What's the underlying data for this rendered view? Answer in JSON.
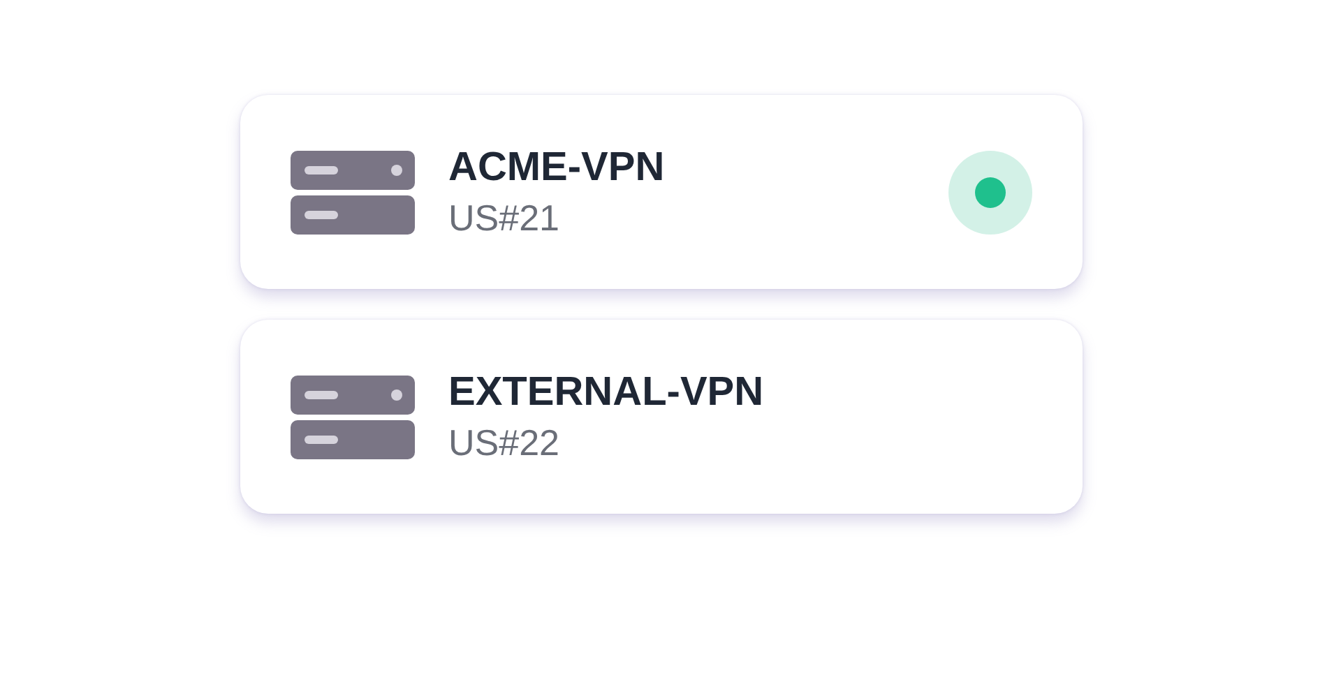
{
  "servers": [
    {
      "name": "ACME-VPN",
      "location": "US#21",
      "connected": true
    },
    {
      "name": "EXTERNAL-VPN",
      "location": "US#22",
      "connected": false
    }
  ]
}
